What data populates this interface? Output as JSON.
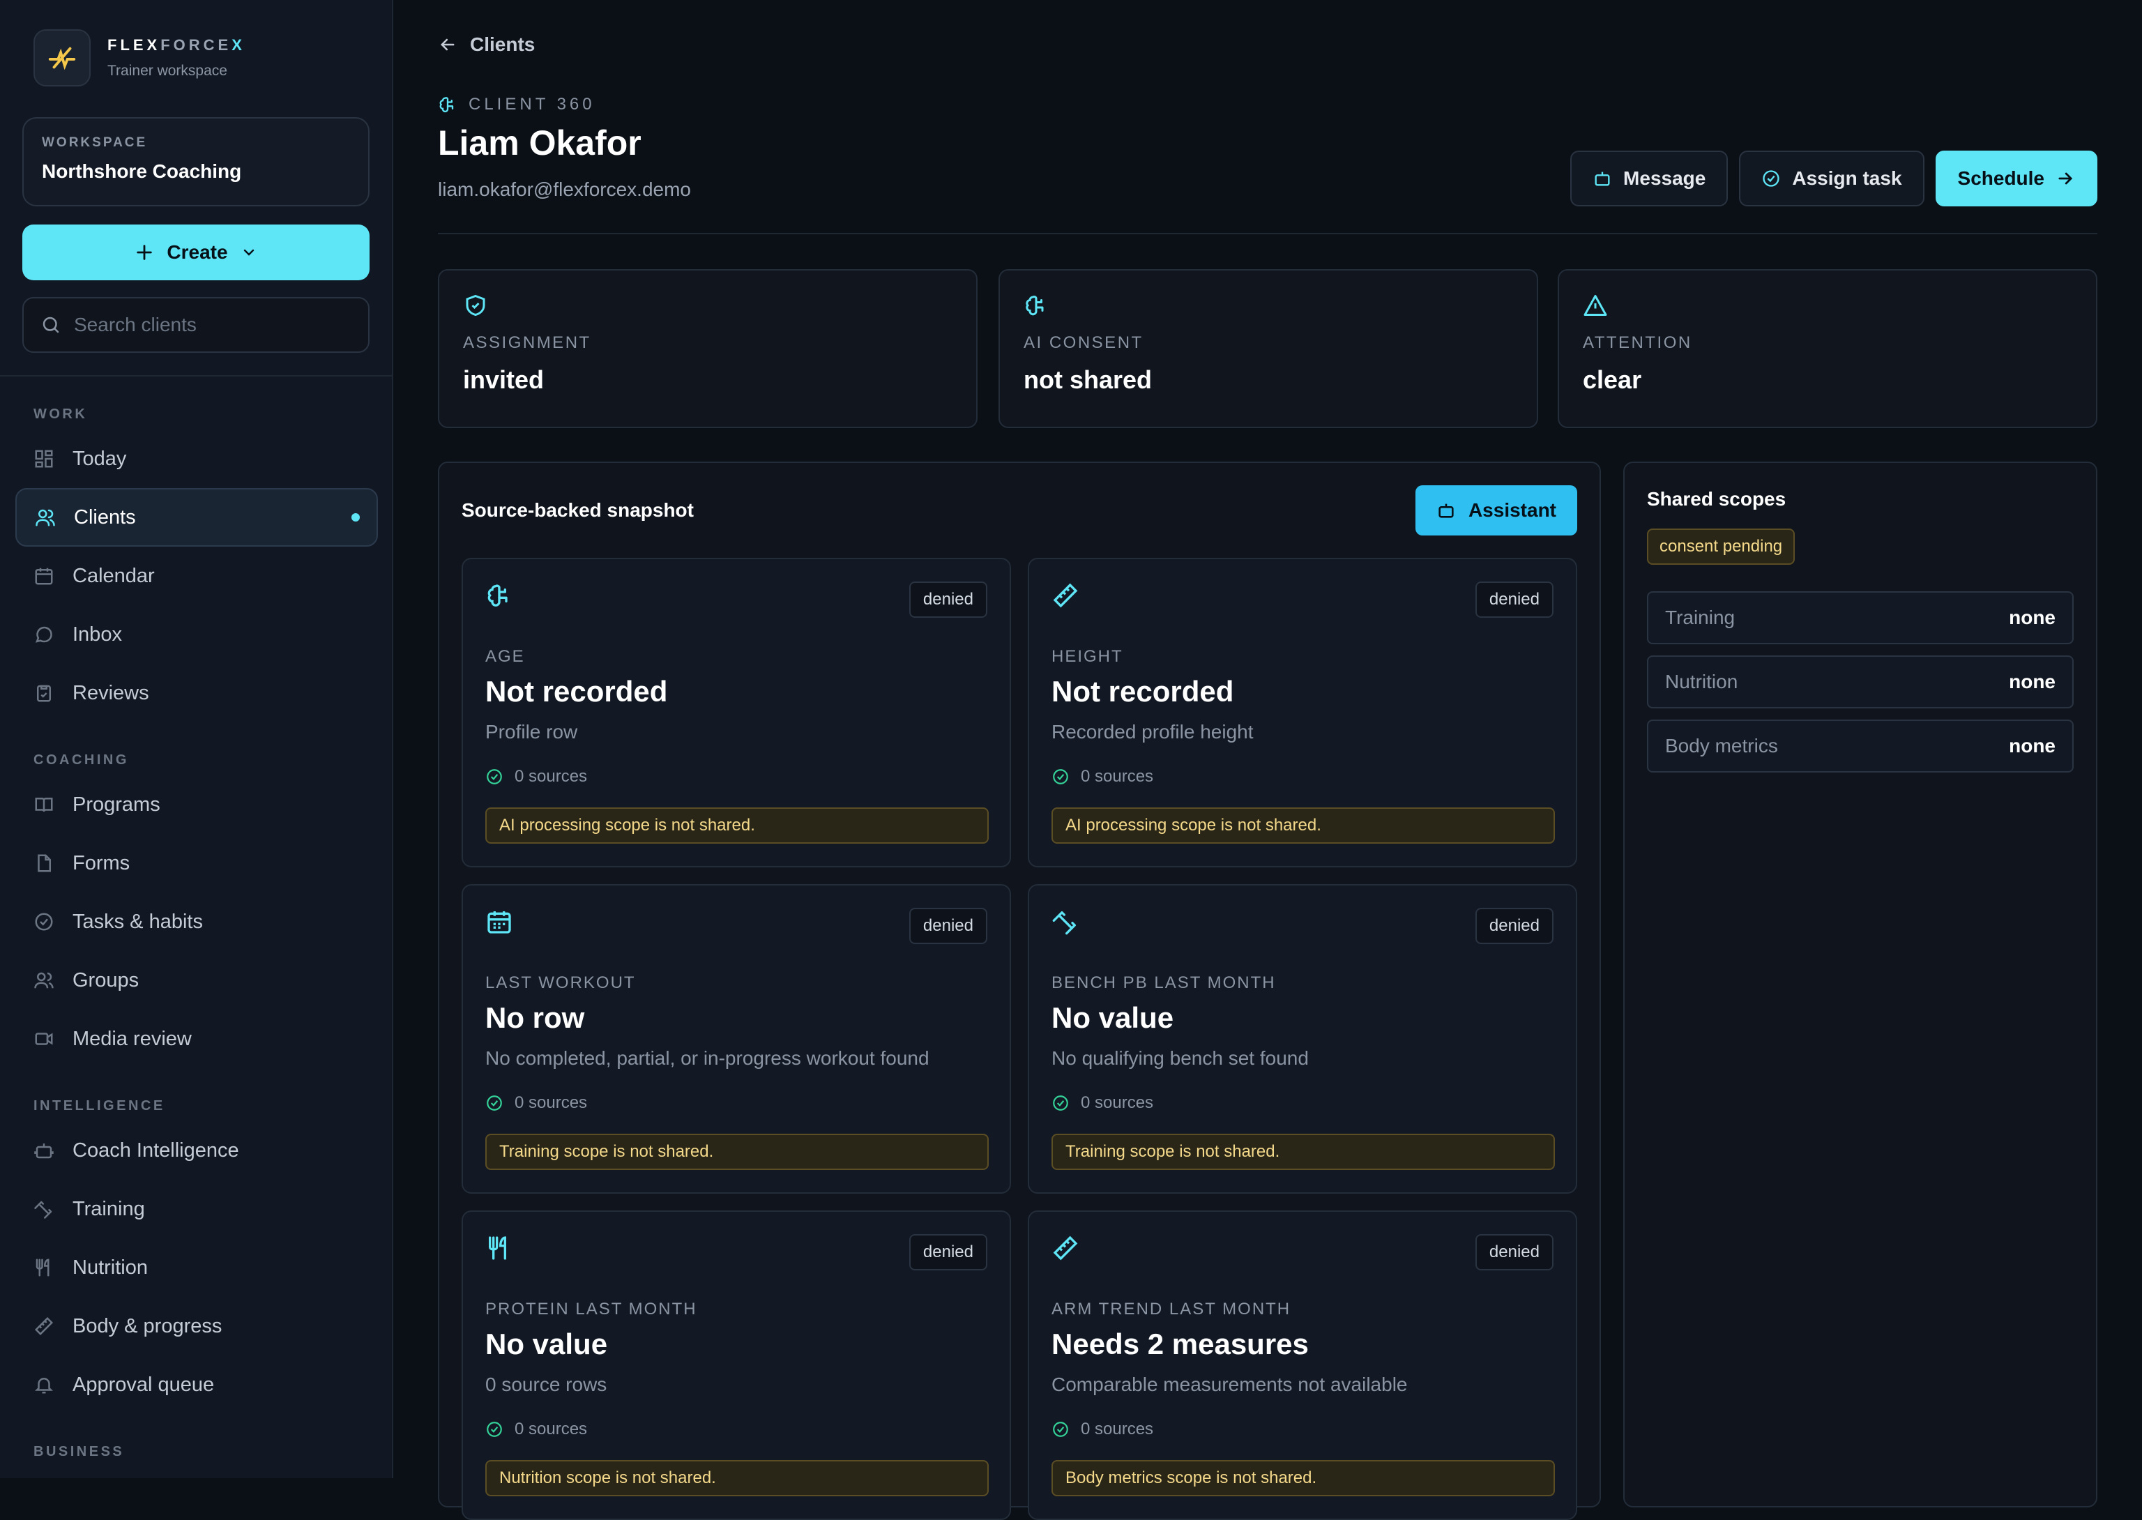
{
  "brand": {
    "name_a": "FLEX",
    "name_b": "FORCE",
    "name_c": "X",
    "subtitle": "Trainer workspace"
  },
  "workspace": {
    "label": "WORKSPACE",
    "name": "Northshore Coaching"
  },
  "create_label": "Create",
  "search": {
    "placeholder": "Search clients"
  },
  "nav": {
    "work": "WORK",
    "coaching": "COACHING",
    "intelligence": "INTELLIGENCE",
    "business": "BUSINESS",
    "items": {
      "today": "Today",
      "clients": "Clients",
      "calendar": "Calendar",
      "inbox": "Inbox",
      "reviews": "Reviews",
      "programs": "Programs",
      "forms": "Forms",
      "tasks": "Tasks & habits",
      "groups": "Groups",
      "media": "Media review",
      "coach_intel": "Coach Intelligence",
      "training": "Training",
      "nutrition": "Nutrition",
      "body": "Body & progress",
      "approval": "Approval queue"
    }
  },
  "header": {
    "back": "Clients",
    "eyebrow": "CLIENT 360",
    "name": "Liam Okafor",
    "email": "liam.okafor@flexforcex.demo",
    "actions": {
      "message": "Message",
      "assign": "Assign task",
      "schedule": "Schedule"
    }
  },
  "stats": [
    {
      "label": "ASSIGNMENT",
      "value": "invited",
      "icon": "shield-check-icon"
    },
    {
      "label": "AI CONSENT",
      "value": "not shared",
      "icon": "brain-icon"
    },
    {
      "label": "ATTENTION",
      "value": "clear",
      "icon": "warning-triangle-icon"
    }
  ],
  "snapshot": {
    "title": "Source-backed snapshot",
    "assistant": "Assistant",
    "metrics": [
      {
        "icon": "brain-icon",
        "badge": "denied",
        "label": "AGE",
        "value": "Not recorded",
        "sub": "Profile row",
        "sources": "0 sources",
        "warning": "AI processing scope is not shared."
      },
      {
        "icon": "ruler-icon",
        "badge": "denied",
        "label": "HEIGHT",
        "value": "Not recorded",
        "sub": "Recorded profile height",
        "sources": "0 sources",
        "warning": "AI processing scope is not shared."
      },
      {
        "icon": "calendar-icon",
        "badge": "denied",
        "label": "LAST WORKOUT",
        "value": "No row",
        "sub": "No completed, partial, or in-progress workout found",
        "sources": "0 sources",
        "warning": "Training scope is not shared."
      },
      {
        "icon": "dumbbell-icon",
        "badge": "denied",
        "label": "BENCH PB LAST MONTH",
        "value": "No value",
        "sub": "No qualifying bench set found",
        "sources": "0 sources",
        "warning": "Training scope is not shared."
      },
      {
        "icon": "utensils-icon",
        "badge": "denied",
        "label": "PROTEIN LAST MONTH",
        "value": "No value",
        "sub": "0 source rows",
        "sources": "0 sources",
        "warning": "Nutrition scope is not shared."
      },
      {
        "icon": "ruler-icon",
        "badge": "denied",
        "label": "ARM TREND LAST MONTH",
        "value": "Needs 2 measures",
        "sub": "Comparable measurements not available",
        "sources": "0 sources",
        "warning": "Body metrics scope is not shared."
      }
    ]
  },
  "scopes": {
    "title": "Shared scopes",
    "status": "consent pending",
    "rows": [
      {
        "name": "Training",
        "value": "none"
      },
      {
        "name": "Nutrition",
        "value": "none"
      },
      {
        "name": "Body metrics",
        "value": "none"
      }
    ]
  },
  "colors": {
    "accent": "#5ee6f7",
    "assistant": "#2fbff0",
    "warning_bg": "#2a2617",
    "warning_text": "#f4d98b",
    "background": "#0b0f16"
  }
}
